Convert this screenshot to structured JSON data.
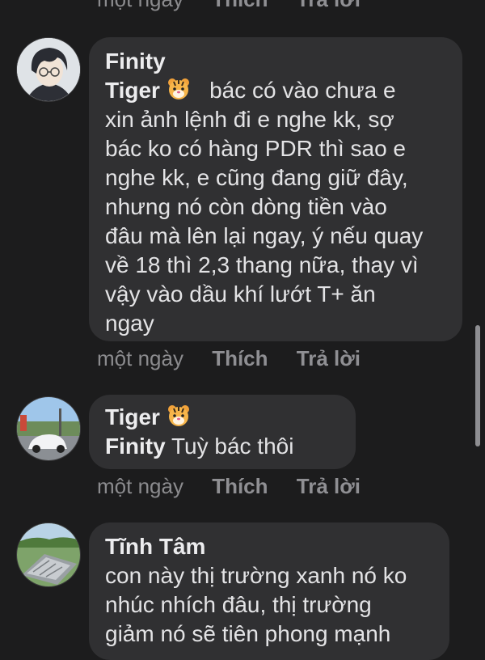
{
  "prev_actions": {
    "time": "một ngày",
    "like": "Thích",
    "reply": "Trả lời"
  },
  "comments": [
    {
      "author": "Finity",
      "mention": "Tiger",
      "text_first": "bác có vào chưa e",
      "lines": [
        "xin ảnh lệnh đi e nghe kk, sợ",
        "bác ko có hàng PDR thì sao e",
        "nghe kk, e cũng đang giữ đây,",
        "nhưng nó còn dòng tiền vào",
        "đâu mà lên lại ngay, ý nếu quay",
        "về 18 thì 2,3 thang nữa, thay vì",
        "vậy vào dầu khí lướt T+ ăn",
        "ngay"
      ],
      "actions": {
        "time": "một ngày",
        "like": "Thích",
        "reply": "Trả lời"
      }
    },
    {
      "author": "Tiger",
      "mention": "Finity",
      "text": "Tuỳ bác thôi",
      "actions": {
        "time": "một ngày",
        "like": "Thích",
        "reply": "Trả lời"
      }
    },
    {
      "author": "Tĩnh Tâm",
      "lines": [
        "con này thị trường xanh nó ko",
        "nhúc nhích đâu, thị trường",
        "giảm nó sẽ tiên phong mạnh"
      ]
    }
  ],
  "icons": {
    "tiger": "tiger-face-emoji",
    "avatar1": "anime-avatar",
    "avatar2": "car-photo-avatar",
    "avatar3": "landscape-photo-avatar"
  },
  "colors": {
    "background": "#1c1c1d",
    "bubble": "#303032",
    "meta": "#8b8b8e"
  }
}
